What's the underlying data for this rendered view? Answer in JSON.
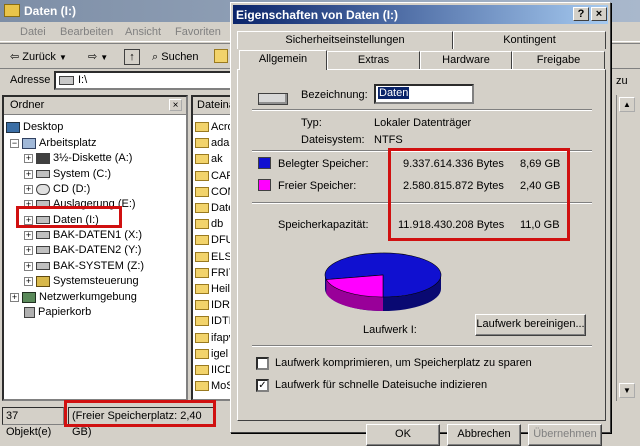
{
  "explorer": {
    "title": "Daten (I:)",
    "menu": [
      "Datei",
      "Bearbeiten",
      "Ansicht",
      "Favoriten"
    ],
    "toolbar": {
      "back": "Zurück",
      "search": "Suchen"
    },
    "address_label": "Adresse",
    "address_value": "I:\\",
    "folders_header": "Ordner",
    "tree": [
      {
        "label": "Desktop"
      },
      {
        "label": "Arbeitsplatz"
      },
      {
        "label": "3½-Diskette (A:)"
      },
      {
        "label": "System (C:)"
      },
      {
        "label": "CD (D:)"
      },
      {
        "label": "Auslagerung (E:)"
      },
      {
        "label": "Daten (I:)"
      },
      {
        "label": "BAK-DATEN1 (X:)"
      },
      {
        "label": "BAK-DATEN2 (Y:)"
      },
      {
        "label": "BAK-SYSTEM (Z:)"
      },
      {
        "label": "Systemsteuerung"
      },
      {
        "label": "Netzwerkumgebung"
      },
      {
        "label": "Papierkorb"
      }
    ],
    "files_header": "Dateina",
    "files": [
      "Acro",
      "adak",
      "ak",
      "CAR",
      "COM",
      "Date",
      "db",
      "DFUI",
      "ELS",
      "FRIT",
      "Heiln",
      "IDRI",
      "IDTR",
      "ifapv",
      "igel",
      "IICD",
      "MoS"
    ],
    "status": {
      "objects": "37 Objekt(e)",
      "free_space": "(Freier Speicherplatz: 2,40 GB)"
    },
    "right_fragment": "zu"
  },
  "dialog": {
    "title": "Eigenschaften von Daten (I:)",
    "help_btn": "?",
    "close_btn": "×",
    "tabs_row1": [
      "Sicherheitseinstellungen",
      "Kontingent"
    ],
    "tabs_row2": [
      "Allgemein",
      "Extras",
      "Hardware",
      "Freigabe"
    ],
    "name_label": "Bezeichnung:",
    "name_value": "Daten",
    "type_label": "Typ:",
    "type_value": "Lokaler Datenträger",
    "fs_label": "Dateisystem:",
    "fs_value": "NTFS",
    "used_label": "Belegter Speicher:",
    "used_bytes": "9.337.614.336 Bytes",
    "used_gb": "8,69 GB",
    "free_label": "Freier Speicher:",
    "free_bytes": "2.580.815.872 Bytes",
    "free_gb": "2,40 GB",
    "cap_label": "Speicherkapazität:",
    "cap_bytes": "11.918.430.208 Bytes",
    "cap_gb": "11,0 GB",
    "drive_label": "Laufwerk I:",
    "cleanup_btn": "Laufwerk bereinigen...",
    "compress_label": "Laufwerk komprimieren, um Speicherplatz zu sparen",
    "compress_checked": false,
    "index_label": "Laufwerk für schnelle Dateisuche indizieren",
    "index_checked": true,
    "ok_btn": "OK",
    "cancel_btn": "Abbrechen",
    "apply_btn": "Übernehmen",
    "colors": {
      "used": "#1010d0",
      "free": "#ff00ff",
      "highlight": "#d01010"
    }
  }
}
